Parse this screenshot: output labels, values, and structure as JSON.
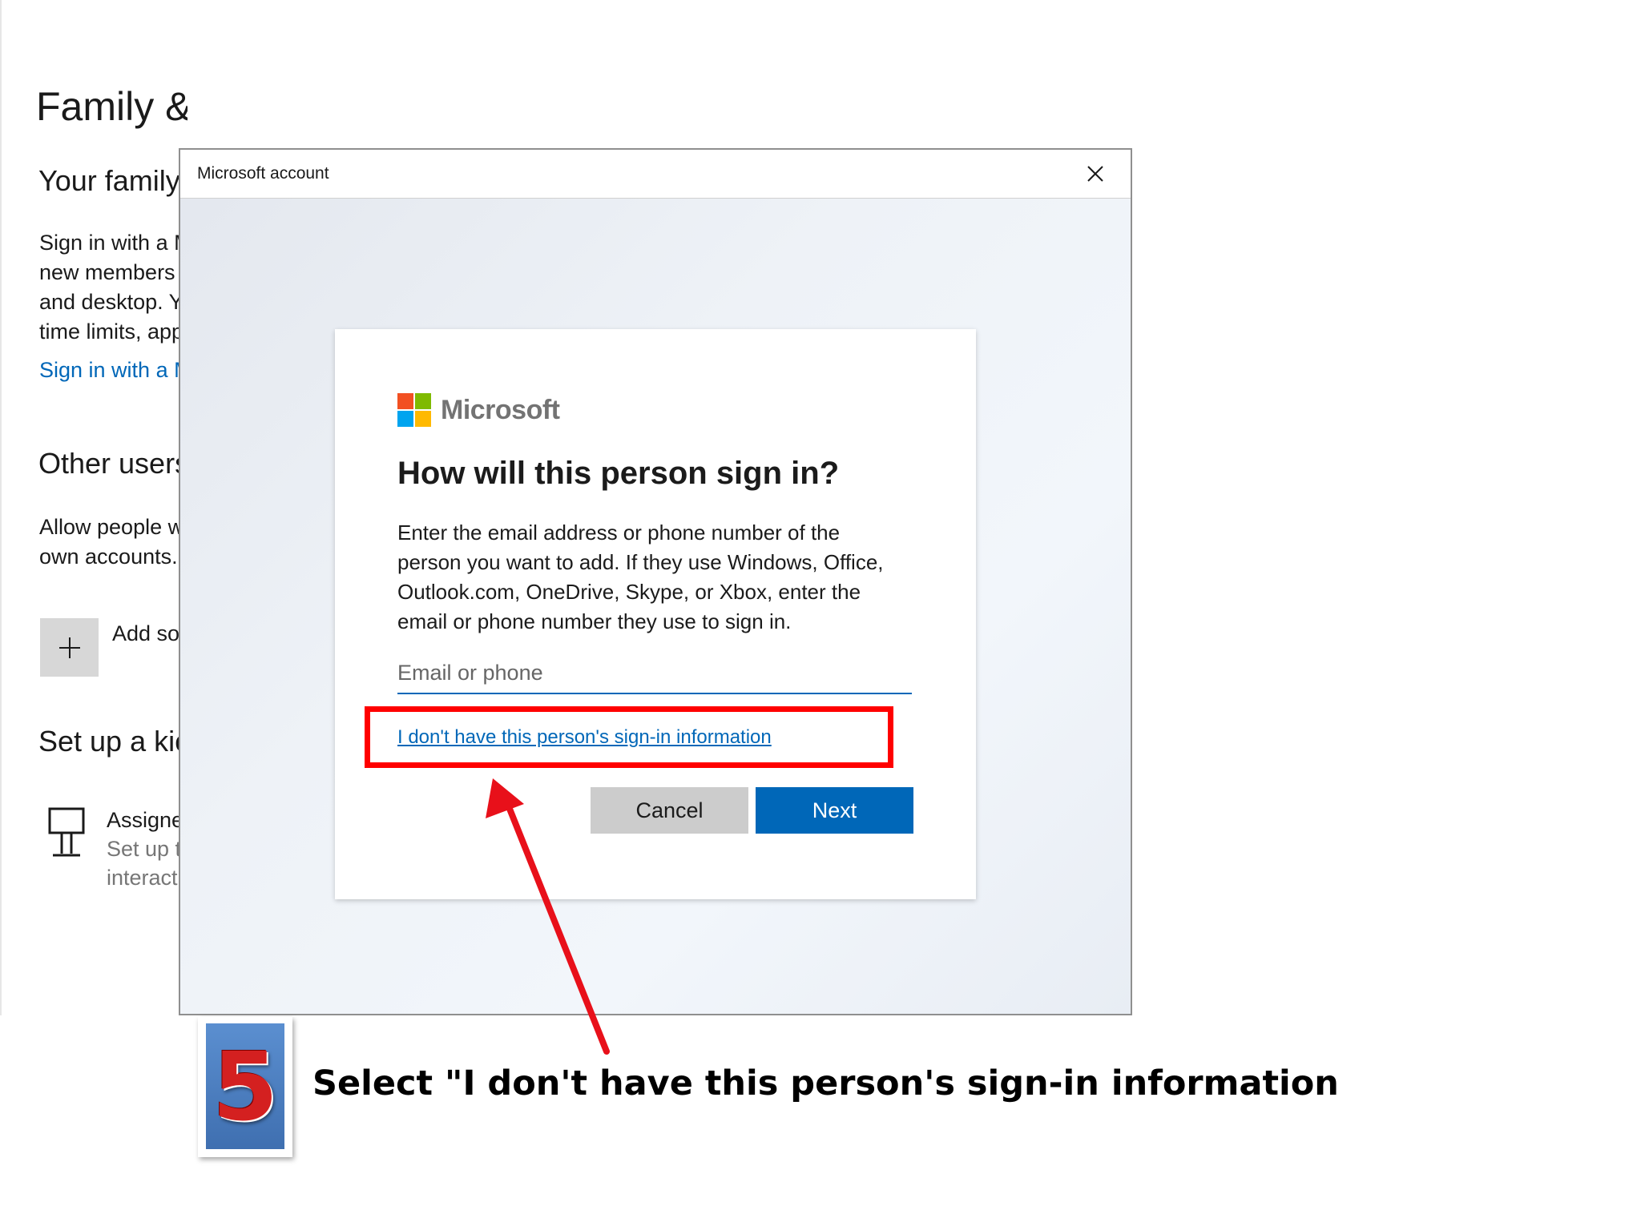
{
  "settings": {
    "page_title": "Family & other users",
    "your_family_heading": "Your family",
    "your_family_text": [
      "Sign in with a M",
      "new members",
      "and desktop. Y",
      "time limits, app"
    ],
    "sign_in_link": "Sign in with a M",
    "other_users_heading": "Other users",
    "other_users_text": [
      "Allow people w",
      "own accounts."
    ],
    "add_someone_label": "Add so",
    "kiosk_heading": "Set up a kic",
    "kiosk_title": "Assigne",
    "kiosk_desc": [
      "Set up t",
      "interact"
    ]
  },
  "dialog": {
    "title": "Microsoft account",
    "close_icon": "close-icon"
  },
  "card": {
    "brand": "Microsoft",
    "brand_colors": [
      "#f25022",
      "#7fba00",
      "#00a4ef",
      "#ffb900"
    ],
    "heading": "How will this person sign in?",
    "description_lines": [
      "Enter the email address or phone number of the",
      "person you want to add. If they use Windows, Office,",
      "Outlook.com, OneDrive, Skype, or Xbox, enter the",
      "email or phone number they use to sign in."
    ],
    "email_placeholder": "Email or phone",
    "email_value": "",
    "no_info_link": "I don't have this person's sign-in information",
    "cancel_label": "Cancel",
    "next_label": "Next"
  },
  "annotation": {
    "step_number": "5",
    "caption": "Select \"I don't have this person's sign-in information",
    "highlight_color": "#ff0000"
  }
}
